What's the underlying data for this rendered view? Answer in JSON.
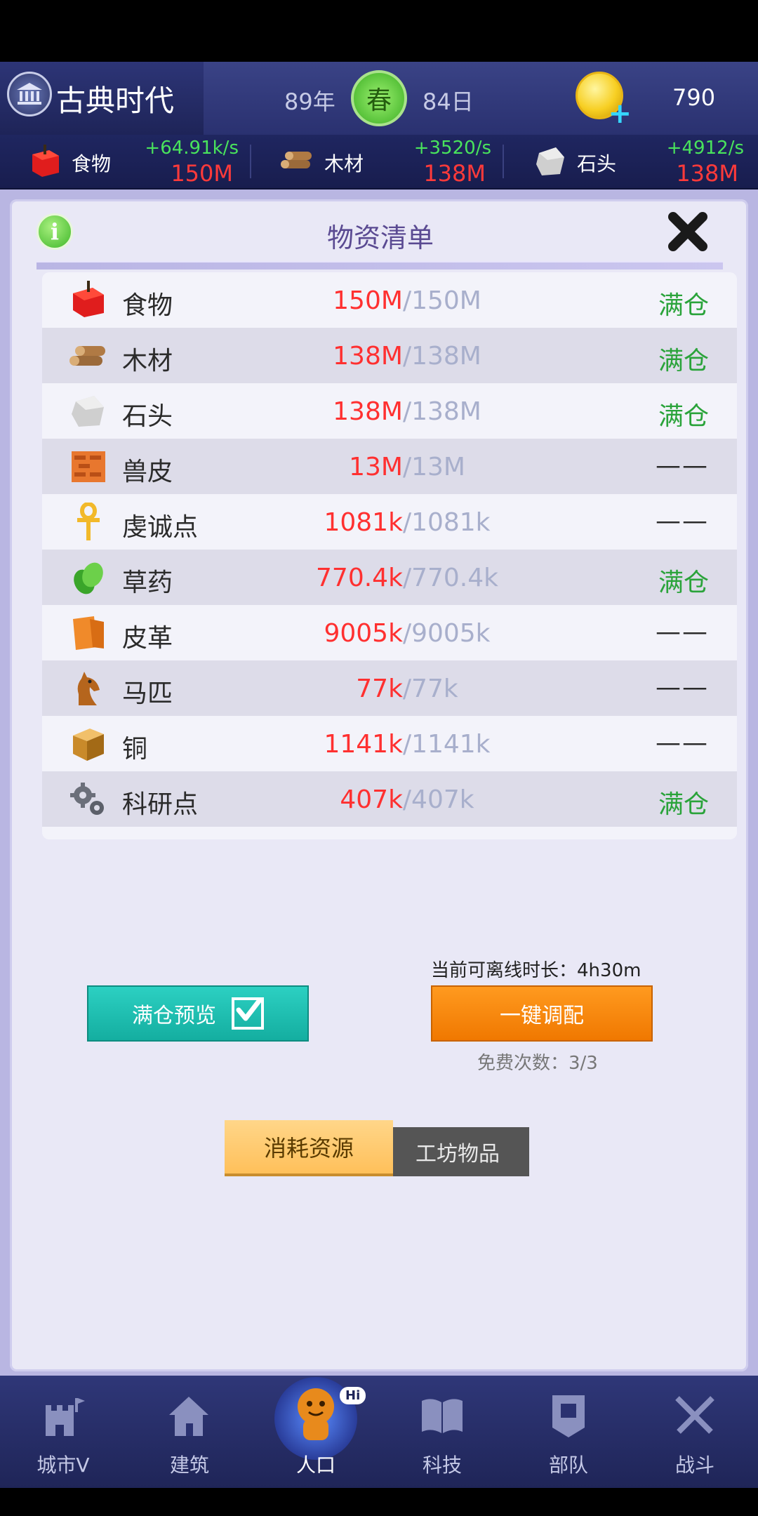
{
  "header": {
    "era_title": "古典时代",
    "year": "89年",
    "season": "春",
    "day": "84日",
    "coins": "790"
  },
  "resource_bar": [
    {
      "name": "食物",
      "rate": "+64.91k/s",
      "amount": "150M",
      "icon": "apple-icon"
    },
    {
      "name": "木材",
      "rate": "+3520/s",
      "amount": "138M",
      "icon": "wood-icon"
    },
    {
      "name": "石头",
      "rate": "+4912/s",
      "amount": "138M",
      "icon": "stone-icon"
    }
  ],
  "panel": {
    "title": "物资清单",
    "rows": [
      {
        "name": "食物",
        "current": "150M",
        "max": "/150M",
        "status": "满仓",
        "icon": "apple-icon"
      },
      {
        "name": "木材",
        "current": "138M",
        "max": "/138M",
        "status": "满仓",
        "icon": "wood-icon"
      },
      {
        "name": "石头",
        "current": "138M",
        "max": "/138M",
        "status": "满仓",
        "icon": "stone-icon"
      },
      {
        "name": "兽皮",
        "current": "13M",
        "max": "/13M",
        "status": "——",
        "icon": "hide-icon"
      },
      {
        "name": "虔诚点",
        "current": "1081k",
        "max": "/1081k",
        "status": "——",
        "icon": "ankh-icon"
      },
      {
        "name": "草药",
        "current": "770.4k",
        "max": "/770.4k",
        "status": "满仓",
        "icon": "herb-icon"
      },
      {
        "name": "皮革",
        "current": "9005k",
        "max": "/9005k",
        "status": "——",
        "icon": "leather-icon"
      },
      {
        "name": "马匹",
        "current": "77k",
        "max": "/77k",
        "status": "——",
        "icon": "horse-icon"
      },
      {
        "name": "铜",
        "current": "1141k",
        "max": "/1141k",
        "status": "——",
        "icon": "copper-icon"
      },
      {
        "name": "科研点",
        "current": "407k",
        "max": "/407k",
        "status": "满仓",
        "icon": "gear-icon"
      }
    ],
    "offline_label": "当前可离线时长：4h30m",
    "preview_button": "满仓预览",
    "allot_button": "一键调配",
    "free_count": "免费次数：3/3",
    "tab_consume": "消耗资源",
    "tab_workshop": "工坊物品"
  },
  "nav": [
    {
      "label": "城市V",
      "icon": "castle-icon"
    },
    {
      "label": "建筑",
      "icon": "house-icon"
    },
    {
      "label": "人口",
      "icon": "population-icon",
      "badge": "Hi"
    },
    {
      "label": "科技",
      "icon": "book-icon"
    },
    {
      "label": "部队",
      "icon": "banner-icon"
    },
    {
      "label": "战斗",
      "icon": "swords-icon"
    }
  ],
  "colors": {
    "accent_green": "#2aa33a",
    "value_red": "#ff3030",
    "button_teal": "#14aea0",
    "button_orange": "#f07800"
  }
}
